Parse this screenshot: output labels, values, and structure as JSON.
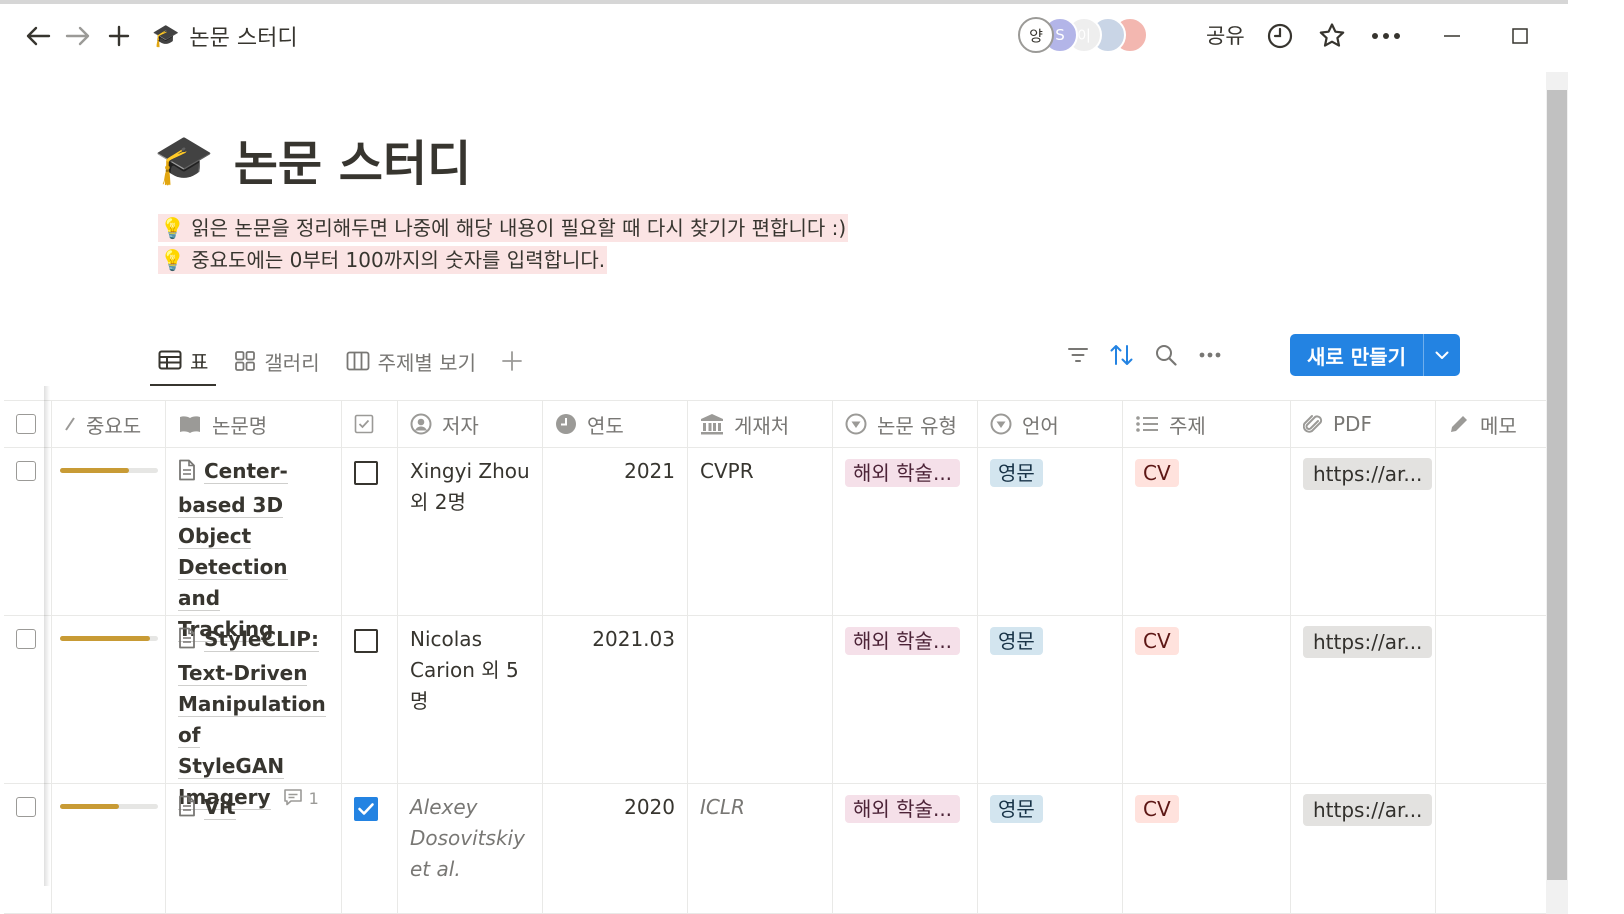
{
  "window": {
    "page_title": "논문 스터디",
    "page_emoji": "🎓",
    "share_label": "공유",
    "avatars": [
      {
        "label": "양",
        "color": "#ffffff"
      },
      {
        "label": "S",
        "color": "#b3b5e8"
      },
      {
        "label": "이",
        "color": "#eeeeee"
      },
      {
        "label": "",
        "color": "#c9d5e6"
      },
      {
        "label": "",
        "color": "#f3b7b0"
      }
    ]
  },
  "page": {
    "title": "논문 스터디",
    "emoji": "🎓",
    "callouts": [
      {
        "icon": "💡",
        "text": "읽은 논문을 정리해두면 나중에 해당 내용이 필요할 때 다시 찾기가 편합니다 :)"
      },
      {
        "icon": "💡",
        "text": "중요도에는 0부터 100까지의 숫자를 입력합니다."
      }
    ]
  },
  "views": {
    "tabs": [
      {
        "label": "표",
        "icon": "table-icon"
      },
      {
        "label": "갤러리",
        "icon": "gallery-icon"
      },
      {
        "label": "주제별 보기",
        "icon": "board-icon"
      }
    ],
    "new_button": "새로 만들기"
  },
  "table": {
    "columns": [
      "중요도",
      "논문명",
      "",
      "저자",
      "연도",
      "게재처",
      "논문 유형",
      "언어",
      "주제",
      "PDF",
      "메모"
    ],
    "rows": [
      {
        "importance": 0.7,
        "title": "Center-based 3D Object Detection and Tracking",
        "title_lines": [
          "Center-",
          "based 3D",
          "Object",
          "Detection and",
          "Tracking"
        ],
        "checked": false,
        "author_lines": [
          "Xingyi Zhou",
          "외 2명"
        ],
        "author_italic": false,
        "year": "2021",
        "venue": "CVPR",
        "venue_italic": false,
        "type": "해외 학술...",
        "language": "영문",
        "topic": "CV",
        "pdf": "https://ar...",
        "comments": ""
      },
      {
        "importance": 0.92,
        "title": "StyleCLIP: Text-Driven Manipulation of StyleGAN Imagery",
        "title_lines": [
          "StyleCLIP:",
          "Text-Driven",
          "Manipulation of",
          "StyleGAN",
          "Imagery"
        ],
        "checked": false,
        "author_lines": [
          "Nicolas",
          "Carion 외 5명"
        ],
        "author_italic": false,
        "year": "2021.03",
        "venue": "",
        "venue_italic": false,
        "type": "해외 학술...",
        "language": "영문",
        "topic": "CV",
        "pdf": "https://ar...",
        "comments": "1"
      },
      {
        "importance": 0.6,
        "title": "Vit",
        "title_lines": [
          "Vit"
        ],
        "checked": true,
        "author_lines": [
          "Alexey",
          "Dosovitskiy",
          "et al."
        ],
        "author_italic": true,
        "year": "2020",
        "venue": "ICLR",
        "venue_italic": true,
        "type": "해외 학술...",
        "language": "영문",
        "topic": "CV",
        "pdf": "https://ar...",
        "comments": ""
      }
    ]
  }
}
